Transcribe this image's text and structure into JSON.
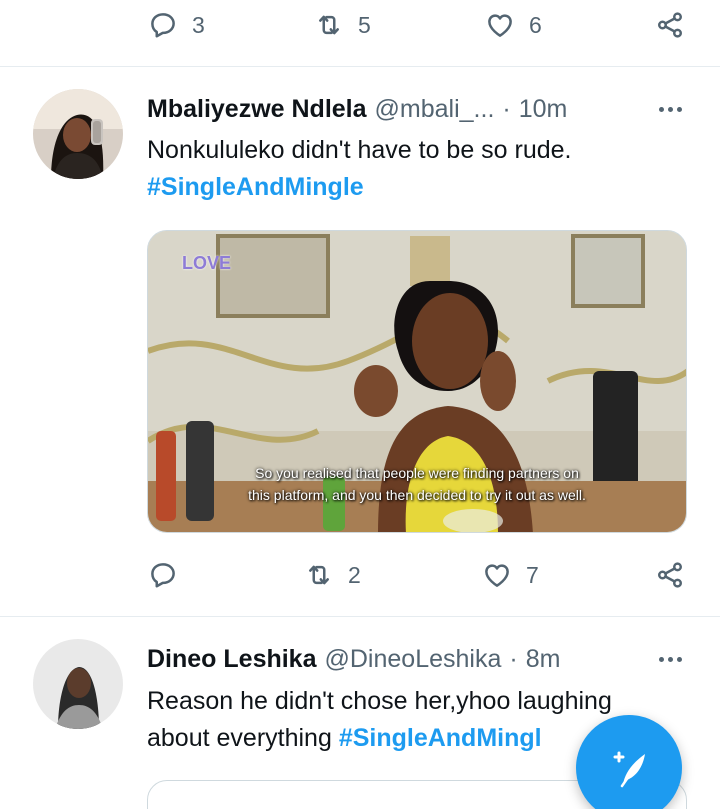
{
  "top_action_bar": {
    "reply_count": "3",
    "retweet_count": "5",
    "like_count": "6"
  },
  "tweets": [
    {
      "display_name": "Mbaliyezwe Ndlela",
      "handle": "@mbali_...",
      "time": "10m",
      "text": "Nonkululeko didn't have to be so rude.",
      "hashtag": "#SingleAndMingle",
      "media": {
        "logo_text": "LOVE",
        "subtitle_line1": "So you realised that people were finding partners on",
        "subtitle_line2": "this platform, and you then decided to try it out as well."
      },
      "reply_count": "",
      "retweet_count": "2",
      "like_count": "7"
    },
    {
      "display_name": "Dineo Leshika",
      "handle": "@DineoLeshika",
      "time": "8m",
      "text_line1": "Reason he didn't chose her,yhoo laughing",
      "text_line2": "about everything",
      "hashtag": "#SingleAndMingl"
    }
  ],
  "fab": {
    "label": "compose-tweet"
  },
  "colors": {
    "accent": "#1d9bf0",
    "muted": "#536471",
    "divider": "#e6ecf0",
    "text": "#0f1419"
  }
}
